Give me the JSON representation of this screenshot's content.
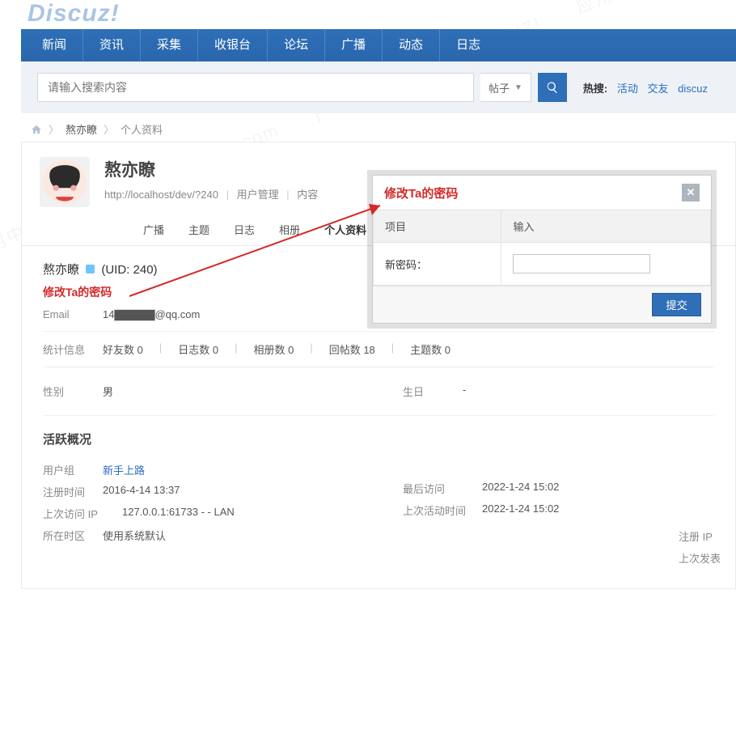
{
  "logo": "Discuz!",
  "nav": [
    "新闻",
    "资讯",
    "采集",
    "收银台",
    "论坛",
    "广播",
    "动态",
    "日志"
  ],
  "search": {
    "placeholder": "请输入搜索内容",
    "category": "帖子"
  },
  "hot": {
    "label": "热搜:",
    "items": [
      "活动",
      "交友",
      "discuz"
    ]
  },
  "crumb": {
    "user": "熬亦瞭",
    "page": "个人资料"
  },
  "profile": {
    "name": "熬亦瞭",
    "url": "http://localhost/dev/?240",
    "links": [
      "用户管理",
      "内容"
    ]
  },
  "tabs": [
    "广播",
    "主题",
    "日志",
    "相册",
    "个人资料"
  ],
  "uid": {
    "name": "熬亦瞭",
    "id": "(UID: 240)"
  },
  "password_link": "修改Ta的密码",
  "email": {
    "label": "Email",
    "value": "14▇▇▇▇▇@qq.com"
  },
  "stats": {
    "label": "统计信息",
    "friends": "好友数 0",
    "logs": "日志数 0",
    "albums": "相册数 0",
    "replies": "回帖数 18",
    "topics": "主题数 0"
  },
  "gender": {
    "label": "性别",
    "value": "男"
  },
  "birthday": {
    "label": "生日",
    "value": "-"
  },
  "activity": {
    "title": "活跃概况",
    "group_label": "用户组",
    "group": "新手上路",
    "reg_label": "注册时间",
    "reg": "2016-4-14 13:37",
    "lastip_label": "上次访问 IP",
    "lastip": "127.0.0.1:61733 - - LAN",
    "tz_label": "所在时区",
    "tz": "使用系统默认",
    "lastvisit_label": "最后访问",
    "lastvisit": "2022-1-24 15:02",
    "lastact_label": "上次活动时间",
    "lastact": "2022-1-24 15:02",
    "regip_label": "注册 IP",
    "lastpost_label": "上次发表"
  },
  "dialog": {
    "title": "修改Ta的密码",
    "col1": "项目",
    "col2": "输入",
    "field": "新密码：",
    "submit": "提交"
  }
}
